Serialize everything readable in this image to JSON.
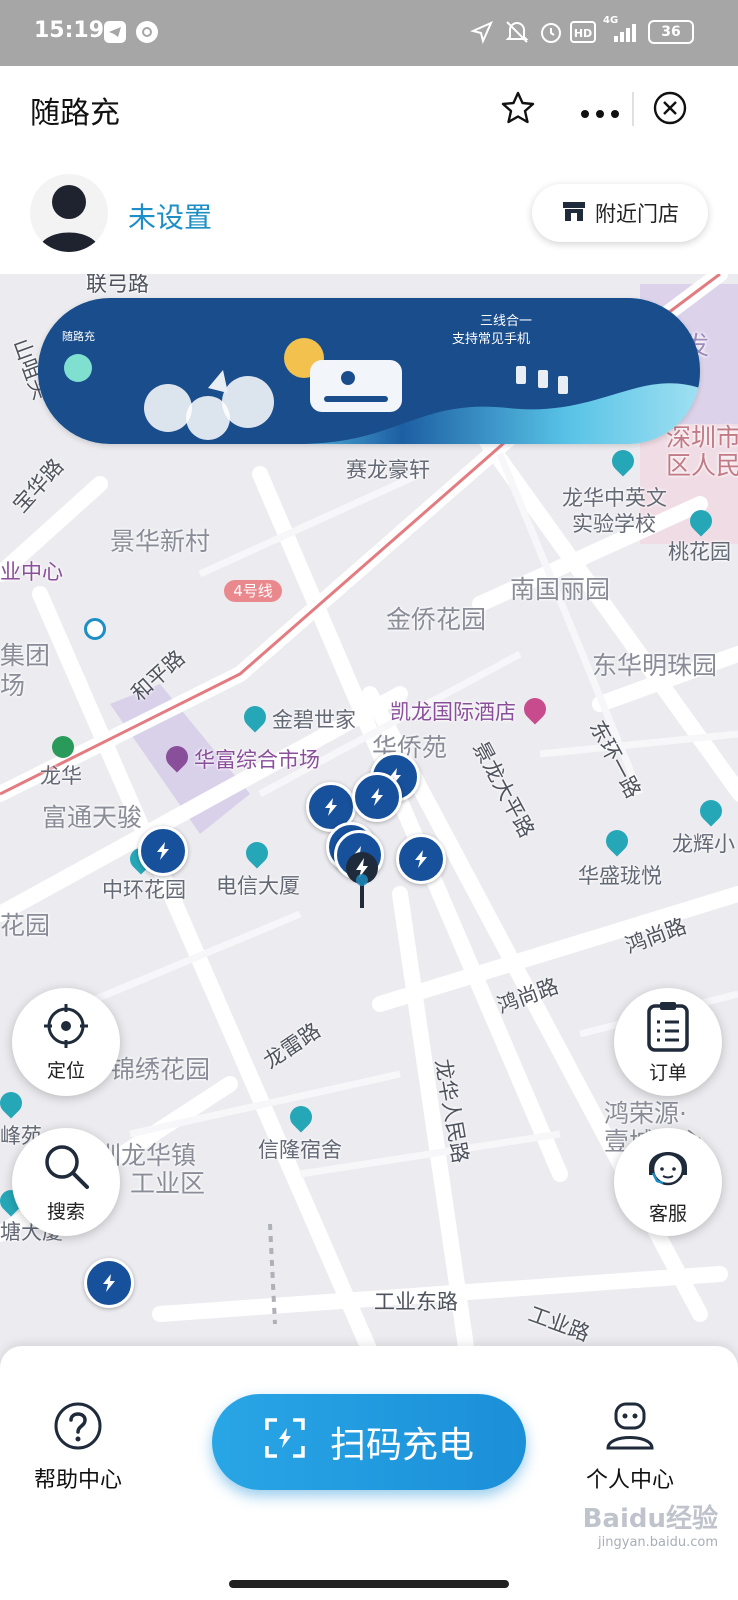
{
  "status": {
    "time": "15:19",
    "network": "4G",
    "battery": "36"
  },
  "header": {
    "title": "随路充"
  },
  "user": {
    "name": "未设置",
    "nearby_label": "附近门店"
  },
  "banner": {
    "brand": "随路充",
    "line1": "三线合一",
    "line2": "支持常见手机"
  },
  "map_labels": {
    "l1": "联弓路",
    "l2": "宝华路",
    "l3": "景华新村",
    "l4": "赛龙豪轩",
    "l5": "龙华中英文",
    "l6": "实验学校",
    "l7": "桃花园",
    "l8": "南国丽园",
    "l9": "金侨花园",
    "l10": "东华明珠园",
    "l11": "和平路",
    "l12": "4号线",
    "l13": "金碧世家",
    "l14": "凯龙国际酒店",
    "l15": "华侨苑",
    "l16": "华富综合市场",
    "l17": "东环一路",
    "l18": "景龙大平路",
    "l19": "龙华",
    "l20": "富通天骏",
    "l21": "中环花园",
    "l22": "电信大厦",
    "l23": "华盛珑悦",
    "l24": "龙辉小",
    "l25": "花园",
    "l26": "鸿尚路",
    "l27": "鸿尚路",
    "l28": "龙雷路",
    "l29": "锦绣花园",
    "l30": "龙华人民路",
    "l31": "信隆宿舍",
    "l32": "鸿荣源·",
    "l33": "壹城中心",
    "l34": "峰苑",
    "l35": "圳龙华镇",
    "l36": "工业区",
    "l37": "塘大厦",
    "l38": "工业东路",
    "l39": "工业路",
    "l40": "深圳市",
    "l41": "区人民",
    "l42": "业中心",
    "l43": "集团",
    "l44": "场",
    "l45": "山咀头",
    "l46": "发"
  },
  "fabs": {
    "locate": "定位",
    "search": "搜索",
    "orders": "订单",
    "service": "客服"
  },
  "bottom": {
    "help": "帮助中心",
    "scan": "扫码充电",
    "profile": "个人中心"
  },
  "watermark": {
    "line1": "Baidu经验",
    "line2": "jingyan.baidu.com"
  },
  "colors": {
    "accent": "#1b8fd8",
    "station": "#17509b",
    "map_bg": "#ecebef"
  }
}
